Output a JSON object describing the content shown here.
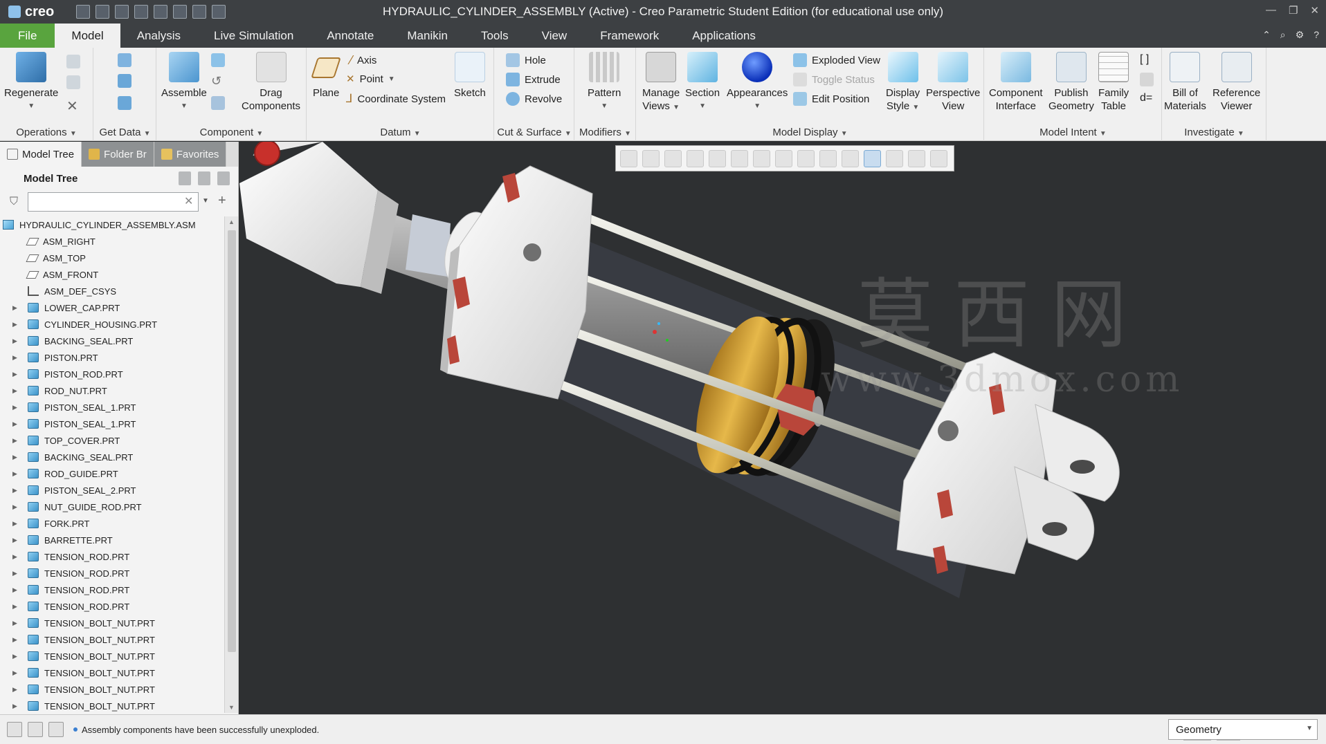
{
  "titlebar": {
    "logo": "creo",
    "title": "HYDRAULIC_CYLINDER_ASSEMBLY (Active) - Creo Parametric Student Edition (for educational use only)"
  },
  "tabs": [
    "File",
    "Model",
    "Analysis",
    "Live Simulation",
    "Annotate",
    "Manikin",
    "Tools",
    "View",
    "Framework",
    "Applications"
  ],
  "ribbon": {
    "operations": {
      "label": "Operations",
      "regenerate": "Regenerate"
    },
    "getdata": {
      "label": "Get Data"
    },
    "component": {
      "label": "Component",
      "assemble": "Assemble",
      "drag_line1": "Drag",
      "drag_line2": "Components"
    },
    "datum": {
      "label": "Datum",
      "plane": "Plane",
      "axis": "Axis",
      "point": "Point",
      "csys": "Coordinate System",
      "sketch": "Sketch"
    },
    "cut": {
      "label": "Cut & Surface",
      "hole": "Hole",
      "extrude": "Extrude",
      "revolve": "Revolve"
    },
    "modifiers": {
      "label": "Modifiers",
      "pattern": "Pattern"
    },
    "display": {
      "label": "Model Display",
      "views_line1": "Manage",
      "views_line2": "Views",
      "section": "Section",
      "appearances": "Appearances",
      "exploded": "Exploded View",
      "toggle": "Toggle Status",
      "edit_position": "Edit Position",
      "style_line1": "Display",
      "style_line2": "Style",
      "persp_line1": "Perspective",
      "persp_line2": "View"
    },
    "intent": {
      "label": "Model Intent",
      "ci_line1": "Component",
      "ci_line2": "Interface",
      "pg_line1": "Publish",
      "pg_line2": "Geometry",
      "ft_line1": "Family",
      "ft_line2": "Table"
    },
    "investigate": {
      "label": "Investigate",
      "bom_line1": "Bill of",
      "bom_line2": "Materials",
      "rv_line1": "Reference",
      "rv_line2": "Viewer"
    }
  },
  "panel": {
    "tabs": [
      "Model Tree",
      "Folder Br",
      "Favorites"
    ],
    "header": "Model Tree",
    "search_value": "",
    "tree": [
      {
        "name": "HYDRAULIC_CYLINDER_ASSEMBLY.ASM",
        "kind": "asm",
        "expandable": false,
        "root": true
      },
      {
        "name": "ASM_RIGHT",
        "kind": "plane",
        "expandable": false
      },
      {
        "name": "ASM_TOP",
        "kind": "plane",
        "expandable": false
      },
      {
        "name": "ASM_FRONT",
        "kind": "plane",
        "expandable": false
      },
      {
        "name": "ASM_DEF_CSYS",
        "kind": "csys",
        "expandable": false
      },
      {
        "name": "LOWER_CAP.PRT",
        "kind": "part",
        "expandable": true
      },
      {
        "name": "CYLINDER_HOUSING.PRT",
        "kind": "part",
        "expandable": true
      },
      {
        "name": "BACKING_SEAL.PRT",
        "kind": "part",
        "expandable": true
      },
      {
        "name": "PISTON.PRT",
        "kind": "part",
        "expandable": true
      },
      {
        "name": "PISTON_ROD.PRT",
        "kind": "part",
        "expandable": true
      },
      {
        "name": "ROD_NUT.PRT",
        "kind": "part",
        "expandable": true
      },
      {
        "name": "PISTON_SEAL_1.PRT",
        "kind": "part",
        "expandable": true
      },
      {
        "name": "PISTON_SEAL_1.PRT",
        "kind": "part",
        "expandable": true
      },
      {
        "name": "TOP_COVER.PRT",
        "kind": "part",
        "expandable": true
      },
      {
        "name": "BACKING_SEAL.PRT",
        "kind": "part",
        "expandable": true
      },
      {
        "name": "ROD_GUIDE.PRT",
        "kind": "part",
        "expandable": true
      },
      {
        "name": "PISTON_SEAL_2.PRT",
        "kind": "part",
        "expandable": true
      },
      {
        "name": "NUT_GUIDE_ROD.PRT",
        "kind": "part",
        "expandable": true
      },
      {
        "name": "FORK.PRT",
        "kind": "part",
        "expandable": true
      },
      {
        "name": "BARRETTE.PRT",
        "kind": "part",
        "expandable": true
      },
      {
        "name": "TENSION_ROD.PRT",
        "kind": "part",
        "expandable": true
      },
      {
        "name": "TENSION_ROD.PRT",
        "kind": "part",
        "expandable": true
      },
      {
        "name": "TENSION_ROD.PRT",
        "kind": "part",
        "expandable": true
      },
      {
        "name": "TENSION_ROD.PRT",
        "kind": "part",
        "expandable": true
      },
      {
        "name": "TENSION_BOLT_NUT.PRT",
        "kind": "part",
        "expandable": true
      },
      {
        "name": "TENSION_BOLT_NUT.PRT",
        "kind": "part",
        "expandable": true
      },
      {
        "name": "TENSION_BOLT_NUT.PRT",
        "kind": "part",
        "expandable": true
      },
      {
        "name": "TENSION_BOLT_NUT.PRT",
        "kind": "part",
        "expandable": true
      },
      {
        "name": "TENSION_BOLT_NUT.PRT",
        "kind": "part",
        "expandable": true
      },
      {
        "name": "TENSION_BOLT_NUT.PRT",
        "kind": "part",
        "expandable": true
      }
    ]
  },
  "viewport": {
    "watermark_line1": "莫西网",
    "watermark_line2": "www.3dmox.com"
  },
  "status": {
    "message": "Assembly components have been successfully unexploded.",
    "filter_value": "Geometry"
  },
  "colors": {
    "file_tab": "#59a43e",
    "titlebar": "#3d4043",
    "viewport_bg": "#2e3032",
    "piston_gold": "#d9a53a",
    "bolt_red": "#b9463a",
    "ring_red": "#c8302b"
  }
}
